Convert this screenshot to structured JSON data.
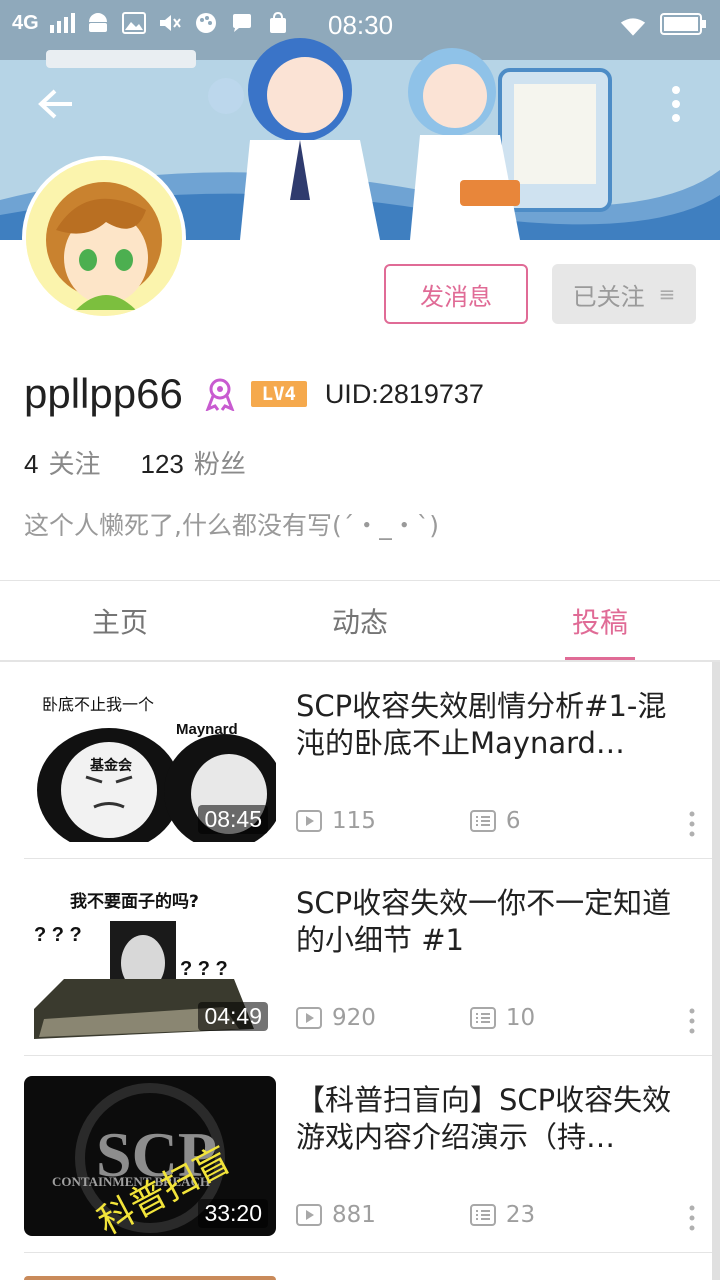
{
  "status_bar": {
    "network": "4G",
    "time": "08:30"
  },
  "profile": {
    "username": "ppllpp66",
    "level": "LV4",
    "uid": "UID:2819737",
    "following_count": "4",
    "following_label": "关注",
    "followers_count": "123",
    "followers_label": "粉丝",
    "bio": "这个人懒死了,什么都没有写(´・_・`)"
  },
  "actions": {
    "message_label": "发消息",
    "followed_label": "已关注",
    "followed_menu": "≡"
  },
  "tabs": [
    {
      "label": "主页",
      "active": false
    },
    {
      "label": "动态",
      "active": false
    },
    {
      "label": "投稿",
      "active": true
    }
  ],
  "videos": [
    {
      "title": "SCP收容失效剧情分析#1-混沌的卧底不止Maynard…",
      "duration": "08:45",
      "views": "115",
      "comments": "6",
      "thumb_text": [
        "卧底不止我一个",
        "Maynard",
        "基金会"
      ]
    },
    {
      "title": "SCP收容失效一你不一定知道的小细节 #1",
      "duration": "04:49",
      "views": "920",
      "comments": "10",
      "thumb_text": [
        "我不要面子的吗?",
        "? ? ?",
        "? ? ?"
      ]
    },
    {
      "title": "【科普扫盲向】SCP收容失效游戏内容介绍演示（持…",
      "duration": "33:20",
      "views": "881",
      "comments": "23",
      "thumb_text": [
        "SCP",
        "CONTAINMENT BREACH",
        "科普扫盲"
      ]
    }
  ],
  "colors": {
    "accent": "#e06b96",
    "level_badge": "#f5a94d",
    "muted": "#9e9e9e"
  },
  "icons": [
    "back-arrow-icon",
    "more-vert-icon",
    "medal-icon",
    "play-count-icon",
    "comment-icon",
    "wifi-icon",
    "battery-icon",
    "signal-icon"
  ]
}
